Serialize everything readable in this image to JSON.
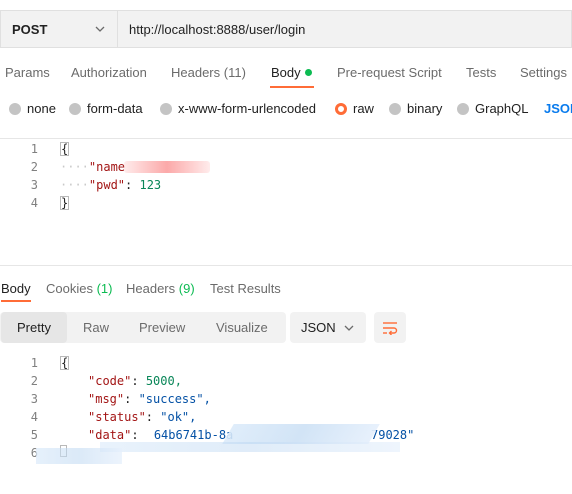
{
  "request": {
    "method": "POST",
    "url": "http://localhost:8888/user/login"
  },
  "request_tabs": [
    {
      "label": "Params"
    },
    {
      "label": "Authorization"
    },
    {
      "label": "Headers",
      "count": "(11)"
    },
    {
      "label": "Body",
      "active": true
    },
    {
      "label": "Pre-request Script"
    },
    {
      "label": "Tests"
    },
    {
      "label": "Settings"
    }
  ],
  "body_types": {
    "none": "none",
    "form_data": "form-data",
    "urlencoded": "x-www-form-urlencoded",
    "raw": "raw",
    "binary": "binary",
    "graphql": "GraphQL",
    "format": "JSON",
    "selected": "raw"
  },
  "request_body": {
    "lines": [
      "1",
      "2",
      "3",
      "4"
    ],
    "open_brace": "{",
    "close_brace": "}",
    "name_key": "\"name",
    "pwd_key": "\"pwd\"",
    "pwd_value": "123",
    "colon": ": "
  },
  "response_tabs": {
    "body": "Body",
    "cookies": "Cookies",
    "cookies_count": "(1)",
    "headers": "Headers",
    "headers_count": "(9)",
    "test_results": "Test Results"
  },
  "view_modes": {
    "pretty": "Pretty",
    "raw": "Raw",
    "preview": "Preview",
    "visualize": "Visualize",
    "format": "JSON"
  },
  "response_body": {
    "lines": [
      "1",
      "2",
      "3",
      "4",
      "5",
      "6"
    ],
    "open_brace": "{",
    "code_key": "\"code\"",
    "code_value": "5000,",
    "msg_key": "\"msg\"",
    "msg_value": "\"success\",",
    "status_key": "\"status\"",
    "status_value": "\"ok\",",
    "data_key": "\"data\"",
    "data_value_start": "64b6741b-8a",
    "data_value_end": "79028\"",
    "colon": ": "
  },
  "colors": {
    "accent": "#ff6c37",
    "success": "#0cbb52",
    "link": "#097bed"
  }
}
